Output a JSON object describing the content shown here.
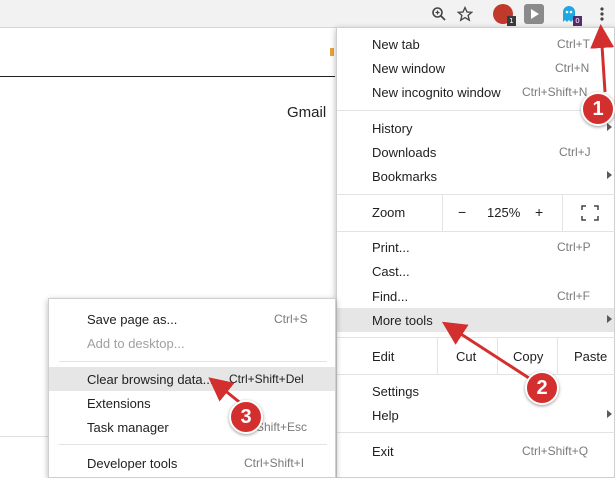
{
  "toolbar": {
    "icons": [
      "zoom-icon",
      "star-icon"
    ],
    "extensions": [
      {
        "name": "extension-red-icon",
        "color": "#c0392b",
        "badge": "1"
      },
      {
        "name": "extension-play-icon",
        "color": "#8a8a8a"
      },
      {
        "name": "extension-ghost-icon",
        "color": "#1ea7e0",
        "badge": "0"
      }
    ],
    "menu_icon": "more-vert-icon"
  },
  "page": {
    "gmail_text": "Gmail"
  },
  "main_menu": {
    "new_tab": {
      "label": "New tab",
      "shortcut": "Ctrl+T"
    },
    "new_window": {
      "label": "New window",
      "shortcut": "Ctrl+N"
    },
    "new_incognito": {
      "label": "New incognito window",
      "shortcut": "Ctrl+Shift+N"
    },
    "history": {
      "label": "History"
    },
    "downloads": {
      "label": "Downloads",
      "shortcut": "Ctrl+J"
    },
    "bookmarks": {
      "label": "Bookmarks"
    },
    "zoom": {
      "label": "Zoom",
      "minus": "−",
      "value": "125%",
      "plus": "+",
      "fullscreen_icon": "fullscreen-icon"
    },
    "print": {
      "label": "Print...",
      "shortcut": "Ctrl+P"
    },
    "cast": {
      "label": "Cast..."
    },
    "find": {
      "label": "Find...",
      "shortcut": "Ctrl+F"
    },
    "more_tools": {
      "label": "More tools"
    },
    "edit": {
      "label": "Edit",
      "cut": "Cut",
      "copy": "Copy",
      "paste": "Paste"
    },
    "settings": {
      "label": "Settings"
    },
    "help": {
      "label": "Help"
    },
    "exit": {
      "label": "Exit",
      "shortcut": "Ctrl+Shift+Q"
    }
  },
  "sub_menu": {
    "save_page": {
      "label": "Save page as...",
      "shortcut": "Ctrl+S"
    },
    "add_to_desktop": {
      "label": "Add to desktop..."
    },
    "clear_browsing": {
      "label": "Clear browsing data...",
      "shortcut": "Ctrl+Shift+Del"
    },
    "extensions": {
      "label": "Extensions"
    },
    "task_manager": {
      "label": "Task manager",
      "shortcut": "Shift+Esc"
    },
    "developer_tools": {
      "label": "Developer tools",
      "shortcut": "Ctrl+Shift+I"
    }
  },
  "annotations": {
    "step1": "1",
    "step2": "2",
    "step3": "3",
    "color": "#d32f2f"
  }
}
